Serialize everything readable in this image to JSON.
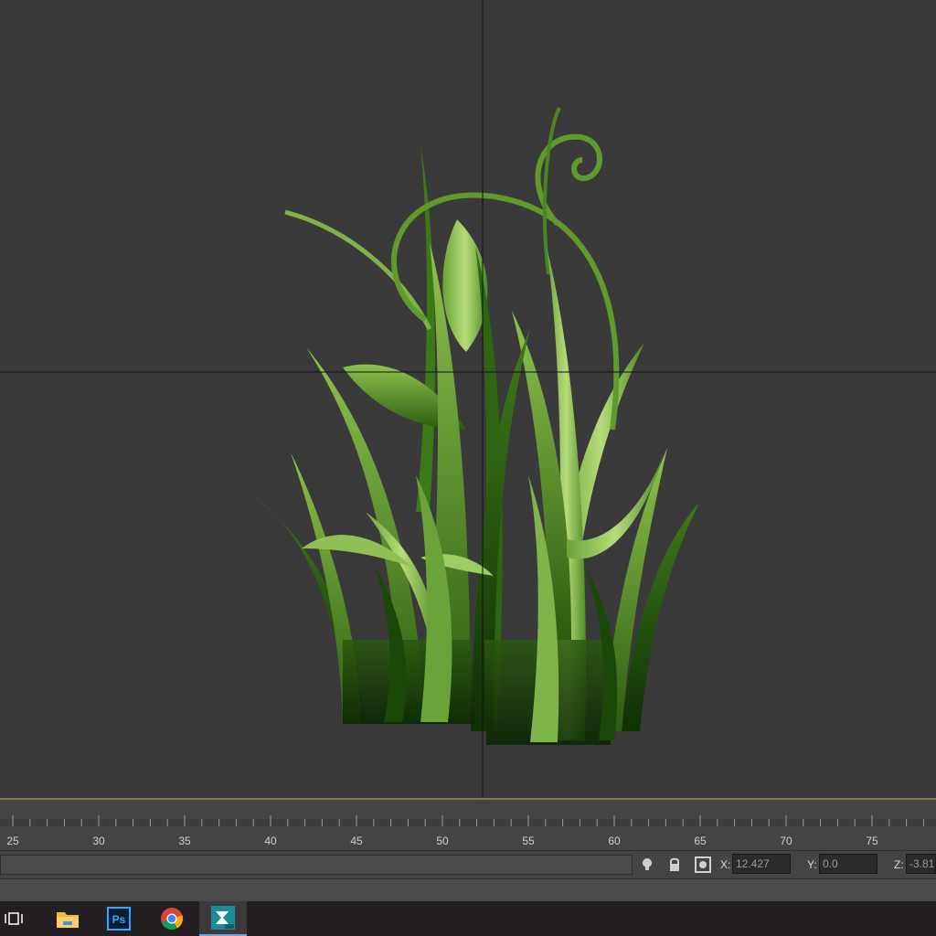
{
  "viewport": {
    "object": "grass-clump-model"
  },
  "timeline": {
    "ticks": [
      {
        "label": "25"
      },
      {
        "label": "30"
      },
      {
        "label": "35"
      },
      {
        "label": "40"
      },
      {
        "label": "45"
      },
      {
        "label": "50"
      },
      {
        "label": "55"
      },
      {
        "label": "60"
      },
      {
        "label": "65"
      },
      {
        "label": "70"
      },
      {
        "label": "75"
      }
    ]
  },
  "statusbar": {
    "icons": [
      "light-bulb-icon",
      "lock-icon",
      "transform-mode-icon"
    ],
    "x_label": "X:",
    "x_value": "12.427",
    "y_label": "Y:",
    "y_value": "0.0",
    "z_label": "Z:",
    "z_value": "-3.81"
  },
  "taskbar": {
    "items": [
      {
        "name": "task-view-icon"
      },
      {
        "name": "file-explorer-icon"
      },
      {
        "name": "photoshop-icon",
        "text": "Ps"
      },
      {
        "name": "chrome-icon"
      },
      {
        "name": "3ds-max-icon",
        "active": true
      }
    ]
  },
  "colors": {
    "viewport_bg": "#3a3a3a",
    "crosshair": "#111111",
    "grass_dark": "#1f4a0c",
    "grass_mid": "#4f8a24",
    "grass_light": "#a7cf68",
    "taskbar_bg": "#231f22",
    "photoshop_blue": "#31a8ff"
  }
}
